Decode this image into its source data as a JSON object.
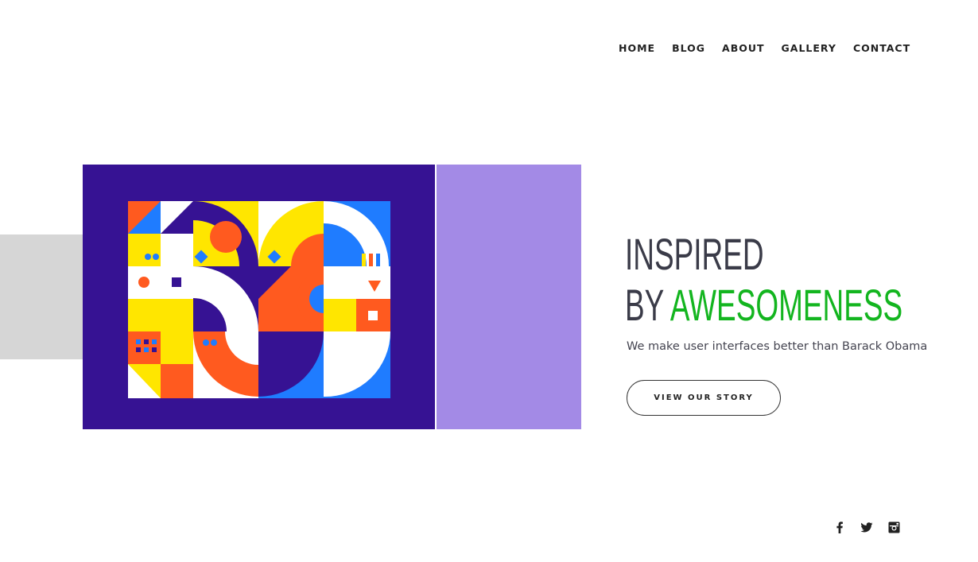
{
  "nav": {
    "items": [
      {
        "label": "HOME"
      },
      {
        "label": "BLOG"
      },
      {
        "label": "ABOUT"
      },
      {
        "label": "GALLERY"
      },
      {
        "label": "CONTACT"
      }
    ]
  },
  "hero": {
    "headline_line1": "INSPIRED",
    "headline_by": "BY ",
    "headline_highlight": "AWESOMENESS",
    "subtitle": "We make user interfaces better than Barack Obama",
    "cta_label": "VIEW OUR STORY"
  },
  "social": {
    "icons": [
      "facebook-icon",
      "twitter-icon",
      "instagram-icon"
    ]
  },
  "colors": {
    "accent": "#13b51f",
    "purple": "#361293",
    "lavender": "#a38ae6",
    "gray": "#d6d6d6"
  }
}
